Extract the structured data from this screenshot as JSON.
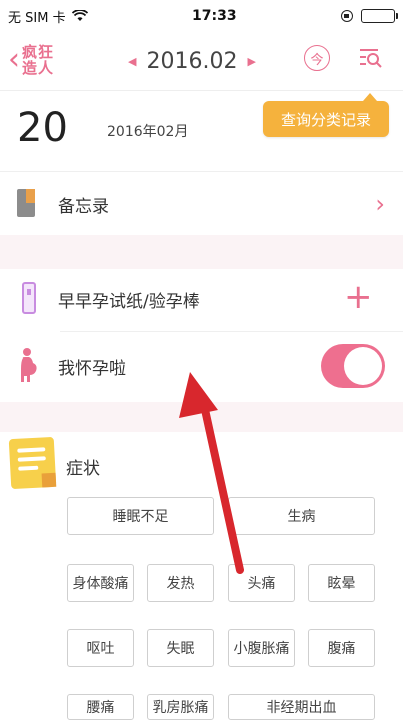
{
  "status_bar": {
    "carrier": "无 SIM 卡",
    "time": "17:33"
  },
  "navbar": {
    "back_icon": "chevron-left-icon",
    "brand": "疯狂造人",
    "month": "2016.02",
    "today_label": "今"
  },
  "date_header": {
    "day": "20",
    "full_date": "2016年02月",
    "tooltip": "查询分类记录"
  },
  "memo": {
    "label": "备忘录"
  },
  "ovulation_test": {
    "label": "早早孕试纸/验孕棒"
  },
  "pregnant": {
    "label": "我怀孕啦",
    "toggle_on": true
  },
  "symptoms": {
    "title": "症状",
    "tags": [
      "睡眠不足",
      "生病",
      "身体酸痛",
      "发热",
      "头痛",
      "眩晕",
      "呕吐",
      "失眠",
      "小腹胀痛",
      "腹痛",
      "腰痛",
      "乳房胀痛",
      "非经期出血"
    ]
  },
  "colors": {
    "accent": "#e9708f",
    "tooltip": "#f5b23d",
    "annotation_arrow": "#d8272d"
  }
}
